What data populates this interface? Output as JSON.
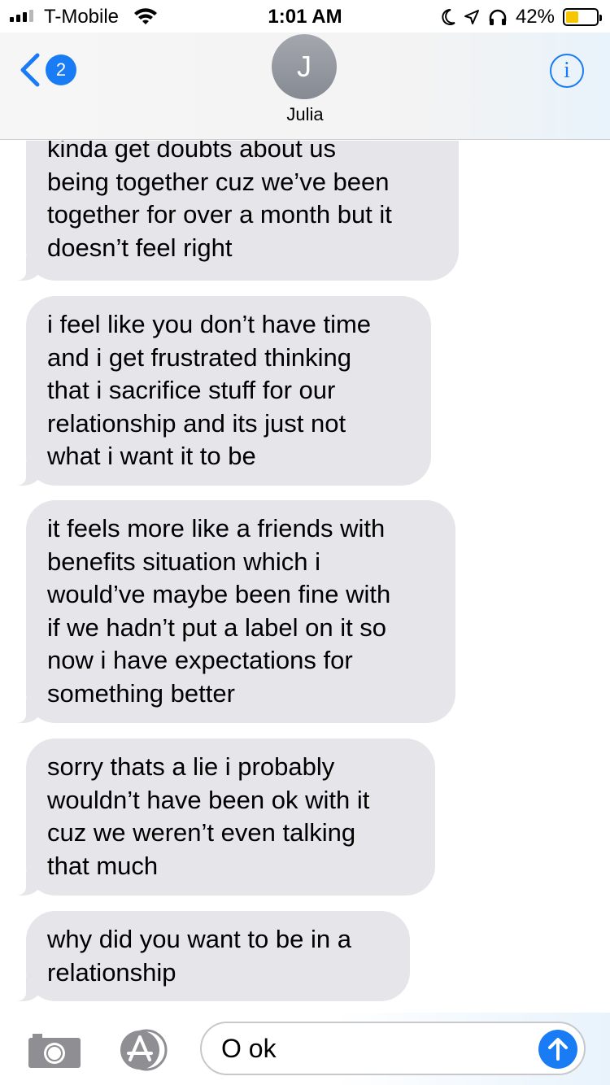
{
  "status_bar": {
    "carrier": "T-Mobile",
    "time": "1:01 AM",
    "battery_percent": "42%",
    "battery_level": 0.42,
    "battery_color": "#f7c600",
    "icons": [
      "signal-icon",
      "wifi-icon",
      "moon-icon",
      "location-icon",
      "headphones-icon",
      "battery-icon"
    ]
  },
  "header": {
    "back_badge": "2",
    "avatar_initial": "J",
    "contact_name": "Julia",
    "info_symbol": "i",
    "accent_color": "#1a7cf5"
  },
  "messages": [
    {
      "sender": "received",
      "text": "kinda get doubts about us\nbeing together cuz we’ve been\ntogether for over a month but it\ndoesn’t feel right"
    },
    {
      "sender": "received",
      "text": "i feel like you don’t have time\nand i get frustrated thinking\nthat i sacrifice stuff for our\nrelationship and its just not\nwhat i want it to be"
    },
    {
      "sender": "received",
      "text": "it feels more like a friends with\nbenefits situation which i\nwould’ve maybe been fine with\nif we hadn’t put a label on it so\nnow i have expectations for\nsomething better"
    },
    {
      "sender": "received",
      "text": "sorry thats a lie i probably\nwouldn’t have been ok with it\ncuz we weren’t even talking\nthat much"
    },
    {
      "sender": "received",
      "text": "why did you want to be in a\nrelationship"
    }
  ],
  "composer": {
    "input_value": "O ok",
    "icons": [
      "camera-icon",
      "app-store-icon",
      "send-arrow-icon"
    ]
  },
  "colors": {
    "received_bubble": "#e5e5ea",
    "send_button": "#1a7cf5"
  }
}
